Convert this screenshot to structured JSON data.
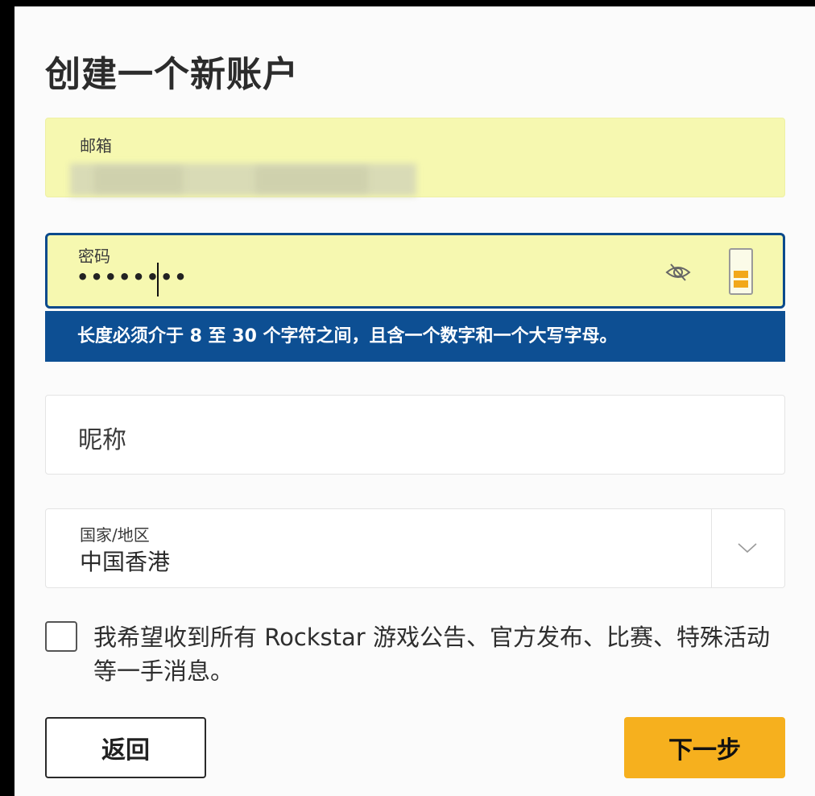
{
  "page": {
    "title": "创建一个新账户"
  },
  "email": {
    "label": "邮箱"
  },
  "password": {
    "label": "密码",
    "masked_value": "••••••••",
    "strength": 0.33
  },
  "password_hint": "长度必须介于 8 至 30 个字符之间，且含一个数字和一个大写字母。",
  "nickname": {
    "placeholder": "昵称"
  },
  "country": {
    "label": "国家/地区",
    "value": "中国香港"
  },
  "consent": {
    "text": "我希望收到所有 Rockstar 游戏公告、官方发布、比赛、特殊活动等一手消息。",
    "checked": false
  },
  "buttons": {
    "back": "返回",
    "next": "下一步"
  },
  "colors": {
    "autofill": "#f6f8b0",
    "focus_border": "#0b4a8c",
    "hint_bg": "#0d4f93",
    "primary": "#f6b01e"
  }
}
